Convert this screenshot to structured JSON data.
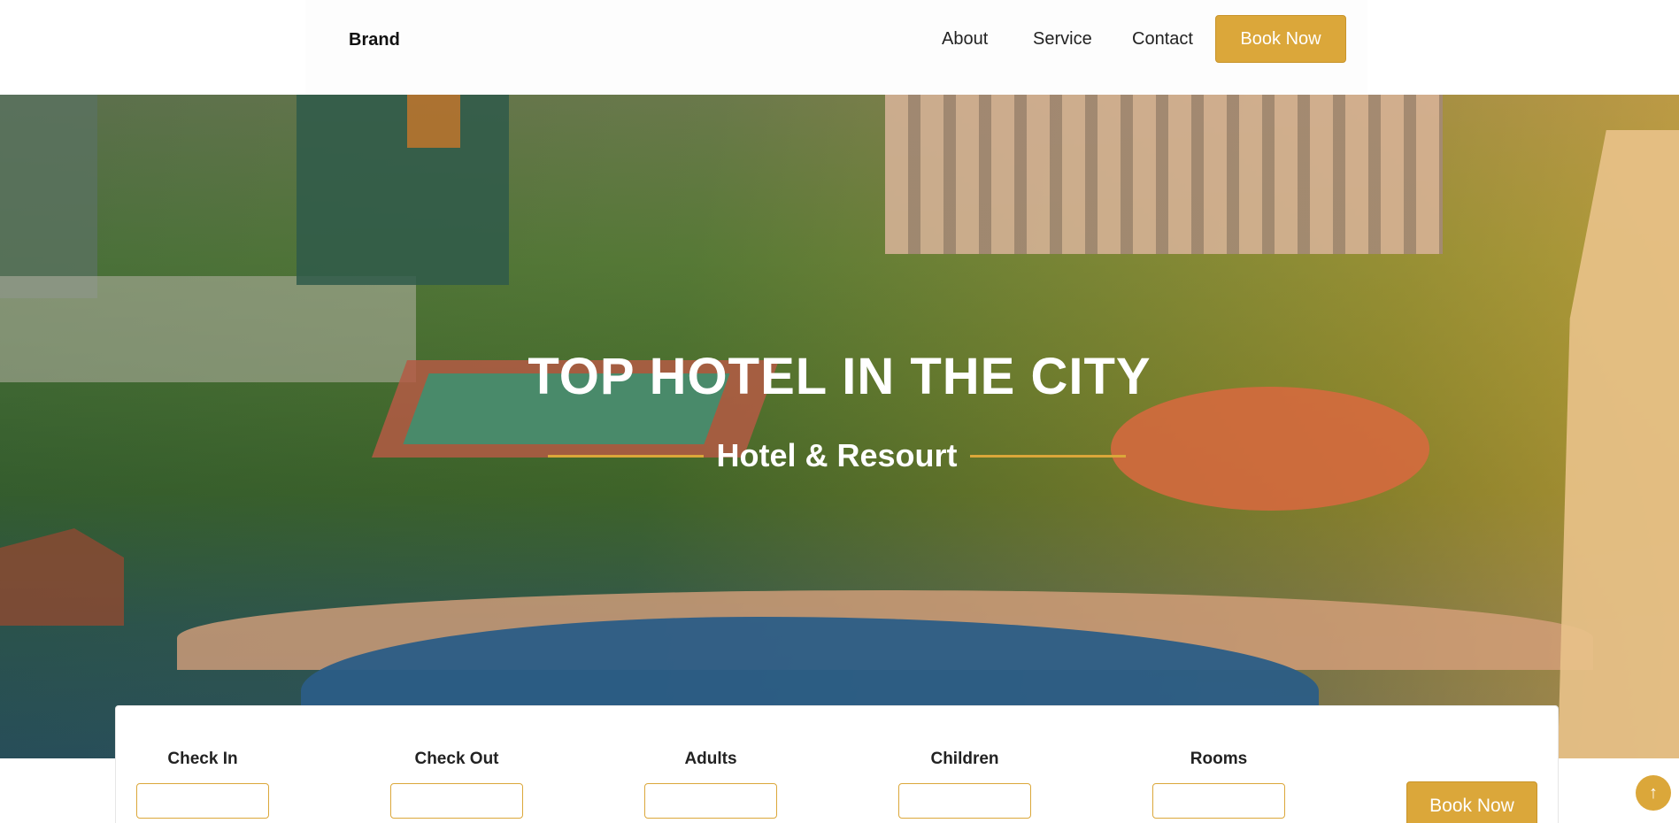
{
  "header": {
    "brand": "Brand",
    "nav": {
      "about": "About",
      "service": "Service",
      "contact": "Contact",
      "book_now": "Book Now"
    }
  },
  "hero": {
    "title": "TOP HOTEL IN THE CITY",
    "subtitle": "Hotel & Resourt"
  },
  "booking": {
    "fields": [
      {
        "label": "Check In",
        "value": ""
      },
      {
        "label": "Check Out",
        "value": ""
      },
      {
        "label": "Adults",
        "value": ""
      },
      {
        "label": "Children",
        "value": ""
      },
      {
        "label": "Rooms",
        "value": ""
      }
    ],
    "button_label": "Book Now"
  },
  "scroll_top": {
    "icon": "arrow-up-icon",
    "glyph": "↑"
  },
  "colors": {
    "accent": "#dba73a",
    "header_bg": "#ffffff",
    "hero_text": "#ffffff"
  }
}
